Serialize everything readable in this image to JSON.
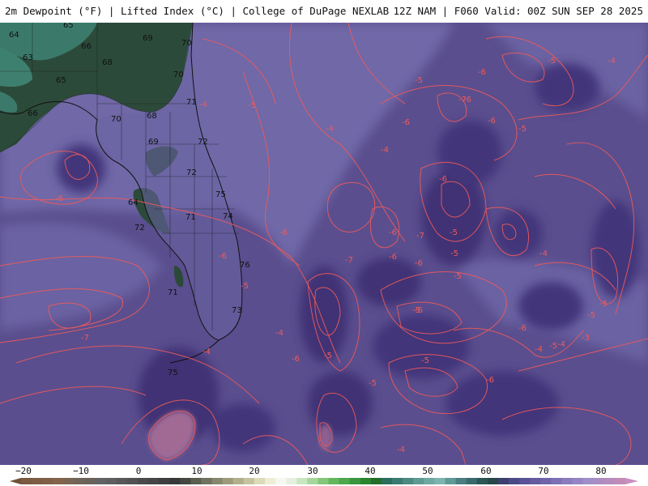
{
  "header": {
    "title_left": "2m Dewpoint (°F) | Lifted Index (°C) | College of DuPage NEXLAB",
    "title_right": "12Z NAM | F060 Valid: 00Z SUN SEP 28 2025"
  },
  "map": {
    "dewpoint_labels": [
      "65",
      "64",
      "69",
      "70",
      "66",
      "63",
      "68",
      "65",
      "70",
      "66",
      "71",
      "70",
      "68",
      "72",
      "69",
      "72",
      "75",
      "64",
      "71",
      "74",
      "72",
      "76",
      "71",
      "73",
      "75"
    ],
    "li_labels": [
      "-4",
      "-5",
      "-4",
      "-6",
      "-5",
      "-4",
      "-5",
      "-6",
      "-7",
      "-6",
      "-5",
      "-6",
      "-4",
      "-6",
      "-5",
      "-7",
      "-6",
      "-6",
      "-5",
      "-4",
      "-6",
      "-5",
      "-7",
      "-5",
      "-6",
      "-4",
      "-5",
      "-5",
      "-6",
      "-3",
      "-4",
      "-5",
      "-6",
      "-5",
      "-6",
      "-4",
      "-6",
      "-5",
      "-5",
      "-6",
      "-4",
      "-7",
      "-5",
      "-6",
      "-4"
    ],
    "colors": {
      "background_ocean": "#5a4e8e",
      "light_purple": "#6f67a7",
      "dark_purple": "#3f3175",
      "moist_green": "#2c4a3a",
      "teal": "#3b7a6a",
      "contour_line": "#f05a5a",
      "coast_line": "#111111"
    }
  },
  "colorbar": {
    "tick_labels": [
      "−20",
      "−10",
      "0",
      "10",
      "20",
      "30",
      "40",
      "50",
      "60",
      "70",
      "80"
    ]
  }
}
